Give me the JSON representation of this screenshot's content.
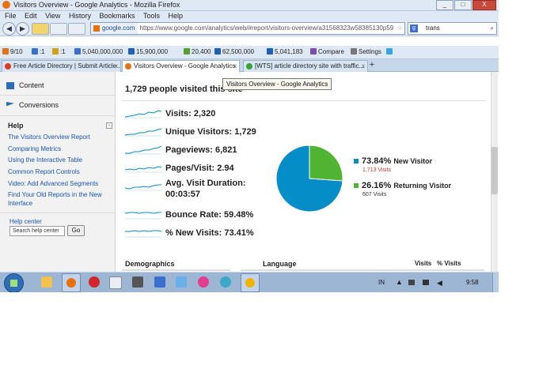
{
  "window": {
    "title": "Visitors Overview - Google Analytics - Mozilla Firefox",
    "buttons": [
      "_",
      "□",
      "X"
    ]
  },
  "menu": [
    "File",
    "Edit",
    "View",
    "History",
    "Bookmarks",
    "Tools",
    "Help"
  ],
  "nav": {
    "back": "◀",
    "forward": "▶",
    "site": "google.com",
    "url": "https://www.google.com/analytics/web/#report/visitors-overview/a31568323w58385130p59",
    "star": "☆",
    "search_engine": "g",
    "search_value": "trans",
    "search_button": "⌕"
  },
  "toolbar": {
    "items": [
      {
        "label": "9/10",
        "color": "#e8700f"
      },
      {
        "label": ":1",
        "color": "#3a6fd0"
      },
      {
        "label": ":1",
        "color": "#d4a017"
      },
      {
        "label": "5,040,000,000",
        "color": "#3a6fd0"
      },
      {
        "label": "15,900,000",
        "color": "#1e5fb8"
      },
      {
        "label": "20,400",
        "color": "#5aa02c"
      },
      {
        "label": "62,500,000",
        "color": "#1e5fb8"
      },
      {
        "label": "5,041,183",
        "color": "#1e5fb8"
      },
      {
        "label": "Compare",
        "color": "#7a4fb0"
      },
      {
        "label": "Settings",
        "color": "#777777"
      }
    ]
  },
  "tabs": [
    {
      "label": "Free Article Directory | Submit Article...",
      "active": false,
      "color": "#d83b2a"
    },
    {
      "label": "Visitors Overview - Google Analytics",
      "active": true,
      "color": "#e8700f"
    },
    {
      "label": "[WTS] article directory site with traffic...",
      "active": false,
      "color": "#3aa03a"
    }
  ],
  "new_tab": "+",
  "sidebar": {
    "nav": [
      {
        "label": "Content",
        "icon": "content-icon"
      },
      {
        "label": "Conversions",
        "icon": "flag-icon"
      }
    ],
    "help_title": "Help",
    "help_toggle": "-",
    "help_links": [
      "The Visitors Overview Report",
      "Comparing Metrics",
      "Using the Interactive Table",
      "Common Report Controls",
      "Video: Add Advanced Segments",
      "Find Your Old Reports in the New Interface"
    ],
    "help_center_label": "Help center",
    "help_center_placeholder": "Search help center",
    "go_button": "Go"
  },
  "main": {
    "section_title": "1,729 people visited this site",
    "tooltip": "Visitors Overview - Google Analytics",
    "metrics": [
      {
        "label": "Visits: 2,320"
      },
      {
        "label": "Unique Visitors: 1,729"
      },
      {
        "label": "Pageviews: 6,821"
      },
      {
        "label": "Pages/Visit: 2.94"
      },
      {
        "label": "Avg. Visit Duration:",
        "label2": "00:03:57"
      },
      {
        "label": "Bounce Rate: 59.48%"
      },
      {
        "label": "% New Visits: 73.41%"
      }
    ],
    "demographics_title": "Demographics",
    "language_title": "Language",
    "visits_header": "Visits",
    "pct_visits_header": "% Visits"
  },
  "chart_data": {
    "type": "pie",
    "categories": [
      "New Visitor",
      "Returning Visitor"
    ],
    "values": [
      73.84,
      26.16
    ],
    "labels": [
      "73.84%",
      "26.16%"
    ],
    "counts": [
      "1,713 Visits",
      "607 Visits"
    ],
    "colors": [
      "#058dc7",
      "#50b432"
    ]
  },
  "taskbar": {
    "tray_lang": "IN",
    "clock": "9:58"
  }
}
